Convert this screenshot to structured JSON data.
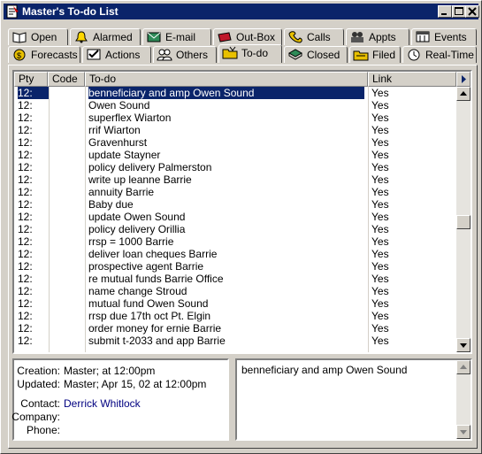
{
  "window": {
    "title": "Master's To-do List"
  },
  "tabs_top": [
    {
      "label": "Open",
      "u": "O",
      "icon": "open-book-icon"
    },
    {
      "label": "Alarmed",
      "u": "A",
      "icon": "alarm-bell-icon"
    },
    {
      "label": "E-mail",
      "u": "E",
      "icon": "email-icon"
    },
    {
      "label": "Out-Box",
      "u": "u",
      "icon": "outbox-icon"
    },
    {
      "label": "Calls",
      "u": "C",
      "icon": "phone-icon"
    },
    {
      "label": "Appts",
      "u": "p",
      "icon": "appointment-icon"
    },
    {
      "label": "Events",
      "u": "v",
      "icon": "events-icon"
    }
  ],
  "tabs_bottom": [
    {
      "label": "Forecasts",
      "u": "F",
      "icon": "money-bag-icon"
    },
    {
      "label": "Actions",
      "u": "A",
      "icon": "actions-icon"
    },
    {
      "label": "Others",
      "u": "O",
      "icon": "people-icon"
    },
    {
      "label": "To-do",
      "u": "T",
      "icon": "todo-folder-icon"
    },
    {
      "label": "Closed",
      "u": "l",
      "icon": "closed-book-icon"
    },
    {
      "label": "Filed",
      "u": "F",
      "icon": "filed-folder-icon"
    },
    {
      "label": "Real-Time",
      "u": "R",
      "icon": "clock-icon"
    }
  ],
  "columns": [
    "Pty",
    "Code",
    "To-do",
    "Link"
  ],
  "rows": [
    {
      "pty": "12:",
      "code": "",
      "todo": "benneficiary and amp Owen Sound",
      "link": "Yes"
    },
    {
      "pty": "12:",
      "code": "",
      "todo": " Owen Sound",
      "link": "Yes"
    },
    {
      "pty": "12:",
      "code": "",
      "todo": "superflex Wiarton",
      "link": "Yes"
    },
    {
      "pty": "12:",
      "code": "",
      "todo": "rrif Wiarton",
      "link": "Yes"
    },
    {
      "pty": "12:",
      "code": "",
      "todo": " Gravenhurst",
      "link": "Yes"
    },
    {
      "pty": "12:",
      "code": "",
      "todo": "update Stayner",
      "link": "Yes"
    },
    {
      "pty": "12:",
      "code": "",
      "todo": "policy delivery Palmerston",
      "link": "Yes"
    },
    {
      "pty": "12:",
      "code": "",
      "todo": "write up leanne Barrie",
      "link": "Yes"
    },
    {
      "pty": "12:",
      "code": "",
      "todo": "annuity Barrie",
      "link": "Yes"
    },
    {
      "pty": "12:",
      "code": "",
      "todo": "Baby due",
      "link": "Yes"
    },
    {
      "pty": "12:",
      "code": "",
      "todo": "update Owen Sound",
      "link": "Yes"
    },
    {
      "pty": "12:",
      "code": "",
      "todo": "policy delivery Orillia",
      "link": "Yes"
    },
    {
      "pty": "12:",
      "code": "",
      "todo": "rrsp = 1000 Barrie",
      "link": "Yes"
    },
    {
      "pty": "12:",
      "code": "",
      "todo": "deliver loan cheques Barrie",
      "link": "Yes"
    },
    {
      "pty": "12:",
      "code": "",
      "todo": "prospective agent Barrie",
      "link": "Yes"
    },
    {
      "pty": "12:",
      "code": "",
      "todo": "re mutual funds Barrie Office",
      "link": "Yes"
    },
    {
      "pty": "12:",
      "code": "",
      "todo": "name change Stroud",
      "link": "Yes"
    },
    {
      "pty": "12:",
      "code": "",
      "todo": "mutual fund Owen Sound",
      "link": "Yes"
    },
    {
      "pty": "12:",
      "code": "",
      "todo": "rrsp due  17th oct Pt. Elgin",
      "link": "Yes"
    },
    {
      "pty": "12:",
      "code": "",
      "todo": "order money for ernie Barrie",
      "link": "Yes"
    },
    {
      "pty": "12:",
      "code": "",
      "todo": "submit t-2033 and app Barrie",
      "link": "Yes"
    }
  ],
  "details": {
    "creation_label": "Creation:",
    "creation_value": "Master;  at 12:00pm",
    "updated_label": "Updated:",
    "updated_value": "Master; Apr 15, 02 at 12:00pm",
    "contact_label": "Contact:",
    "contact_value": "Derrick Whitlock",
    "company_label": "Company:",
    "company_value": "",
    "phone_label": "Phone:",
    "phone_value": ""
  },
  "notes": {
    "text": "benneficiary and amp Owen Sound"
  }
}
